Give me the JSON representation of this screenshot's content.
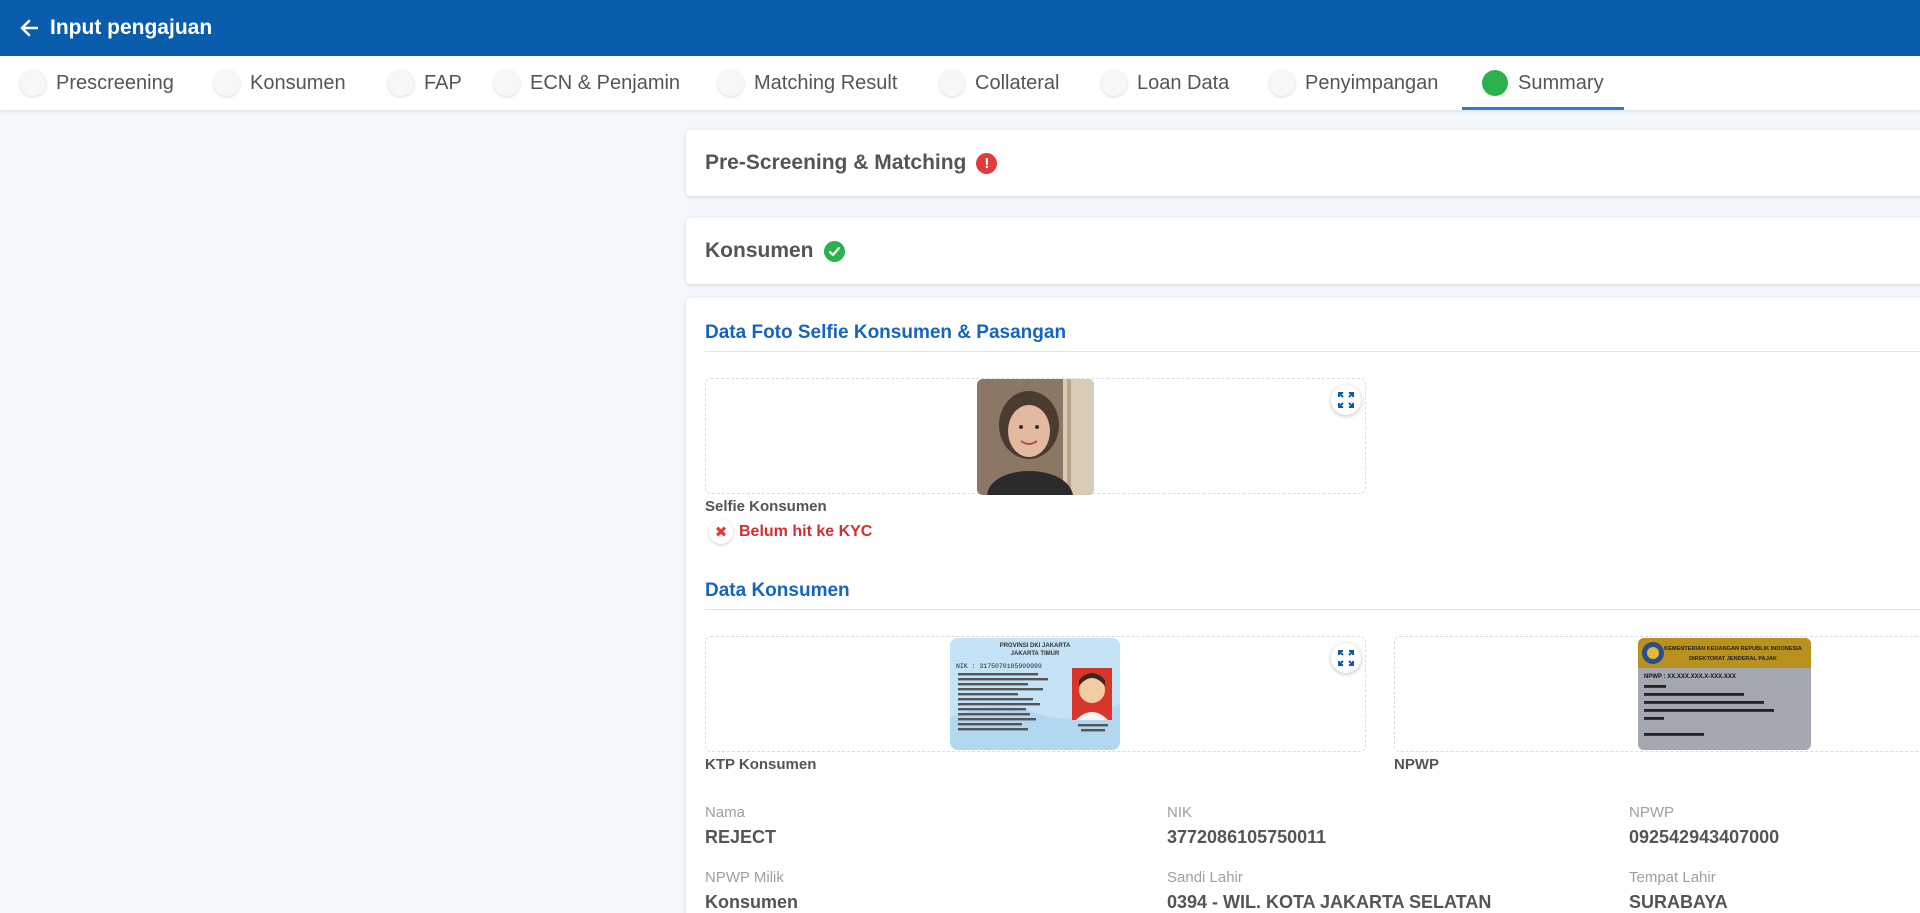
{
  "header": {
    "title": "Input pengajuan"
  },
  "tabs": [
    {
      "label": "Prescreening",
      "active": false
    },
    {
      "label": "Konsumen",
      "active": false
    },
    {
      "label": "FAP",
      "active": false
    },
    {
      "label": "ECN & Penjamin",
      "active": false
    },
    {
      "label": "Matching Result",
      "active": false
    },
    {
      "label": "Collateral",
      "active": false
    },
    {
      "label": "Loan Data",
      "active": false
    },
    {
      "label": "Penyimpangan",
      "active": false
    },
    {
      "label": "Summary",
      "active": true
    }
  ],
  "cards": {
    "prescreening": {
      "title": "Pre-Screening & Matching",
      "status": "error"
    },
    "konsumen": {
      "title": "Konsumen",
      "status": "ok"
    }
  },
  "selfie_section": {
    "title": "Data Foto Selfie Konsumen & Pasangan",
    "selfie_label": "Selfie Konsumen",
    "kyc_status": "Belum hit ke KYC"
  },
  "data_konsumen": {
    "title": "Data Konsumen",
    "ktp_label": "KTP Konsumen",
    "npwp_label": "NPWP",
    "ktp_card": {
      "province": "PROVINSI DKI JAKARTA",
      "city": "JAKARTA TIMUR",
      "nik": "NIK : 3175070105909999"
    },
    "npwp_card": {
      "line1": "KEMENTERIAN KEUANGAN REPUBLIK INDONESIA",
      "line2": "DIREKTORAT JENDERAL PAJAK",
      "npwp_no": "NPWP : XX.XXX.XXX.X-XXX.XXX"
    },
    "fields": [
      {
        "label": "Nama",
        "value": "REJECT"
      },
      {
        "label": "NIK",
        "value": "3772086105750011"
      },
      {
        "label": "NPWP",
        "value": "092542943407000"
      },
      {
        "label": "NPWP Milik",
        "value": "Konsumen"
      },
      {
        "label": "Sandi Lahir",
        "value": "0394 - WIL. KOTA JAKARTA SELATAN"
      },
      {
        "label": "Tempat Lahir",
        "value": "SURABAYA"
      }
    ]
  },
  "colors": {
    "primary": "#0a5cad",
    "success": "#2bb24c",
    "error": "#e03c3c",
    "link": "#1565c0"
  }
}
